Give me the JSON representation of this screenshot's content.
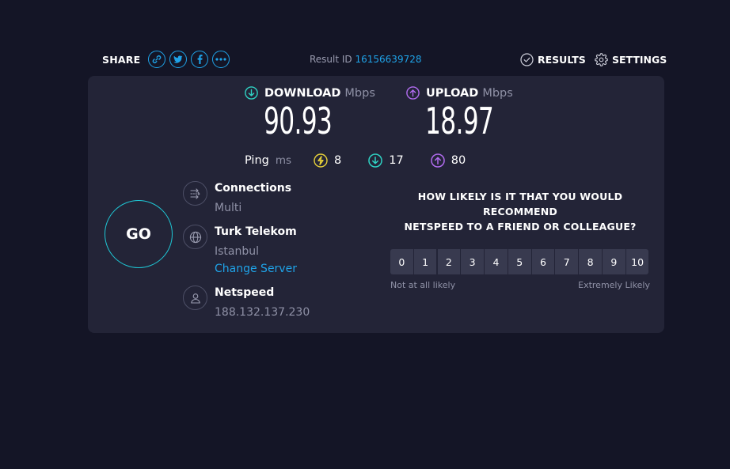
{
  "share": {
    "label": "SHARE",
    "buttons": [
      "link-icon",
      "twitter-icon",
      "facebook-icon",
      "more-icon"
    ]
  },
  "result": {
    "label": "Result ID",
    "id": "16156639728"
  },
  "nav": {
    "results": "RESULTS",
    "settings": "SETTINGS"
  },
  "download": {
    "label": "DOWNLOAD",
    "unit": "Mbps",
    "value": "90.93"
  },
  "upload": {
    "label": "UPLOAD",
    "unit": "Mbps",
    "value": "18.97"
  },
  "ping": {
    "label": "Ping",
    "unit": "ms",
    "idle": "8",
    "download": "17",
    "upload": "80"
  },
  "go": {
    "label": "GO"
  },
  "connections": {
    "title": "Connections",
    "value": "Multi"
  },
  "server": {
    "title": "Turk Telekom",
    "location": "Istanbul",
    "change": "Change Server"
  },
  "host": {
    "title": "Netspeed",
    "ip": "188.132.137.230"
  },
  "nps": {
    "question_line1": "HOW LIKELY IS IT THAT YOU WOULD RECOMMEND",
    "question_line2": "NETSPEED TO A FRIEND OR COLLEAGUE?",
    "scale": [
      "0",
      "1",
      "2",
      "3",
      "4",
      "5",
      "6",
      "7",
      "8",
      "9",
      "10"
    ],
    "low_label": "Not at all likely",
    "high_label": "Extremely Likely"
  },
  "colors": {
    "background": "#141526",
    "card": "#232437",
    "accent_blue": "#1fa3e8",
    "download_cyan": "#2fd3c4",
    "upload_purple": "#b26cf0",
    "ping_yellow": "#e7d13a"
  }
}
